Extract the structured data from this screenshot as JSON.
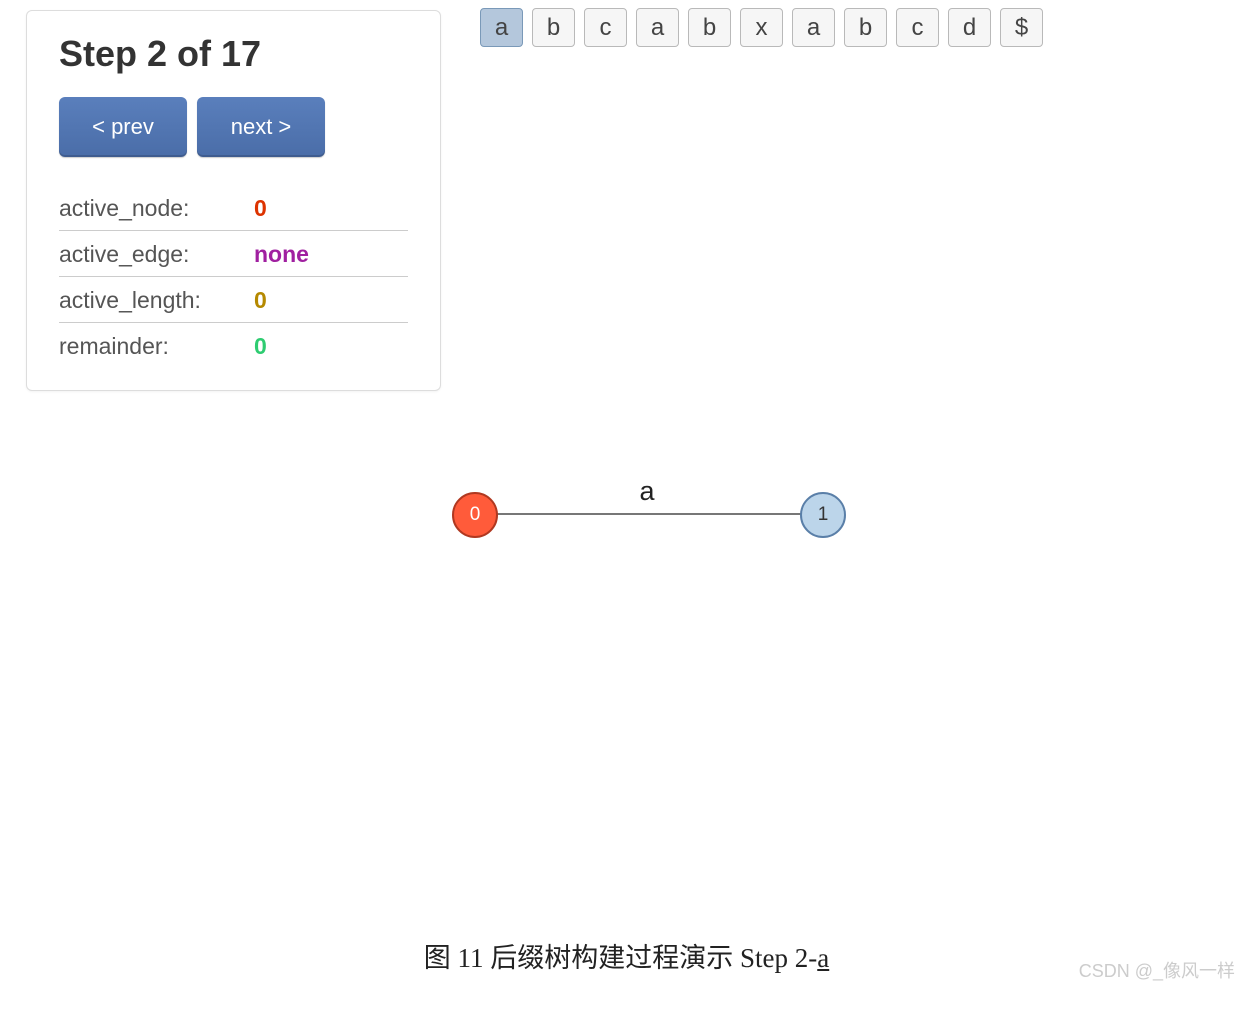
{
  "panel": {
    "title": "Step 2 of 17",
    "prev_label": "< prev",
    "next_label": "next >",
    "stats": {
      "active_node": {
        "label": "active_node:",
        "value": "0",
        "cls": "v-red"
      },
      "active_edge": {
        "label": "active_edge:",
        "value": "none",
        "cls": "v-purple"
      },
      "active_length": {
        "label": "active_length:",
        "value": "0",
        "cls": "v-olive"
      },
      "remainder": {
        "label": "remainder:",
        "value": "0",
        "cls": "v-green"
      }
    }
  },
  "input": {
    "chars": [
      "a",
      "b",
      "c",
      "a",
      "b",
      "x",
      "a",
      "b",
      "c",
      "d",
      "$"
    ],
    "active_index": 0
  },
  "graph": {
    "nodes": [
      {
        "id": "0",
        "cls": "node0"
      },
      {
        "id": "1",
        "cls": "node1"
      }
    ],
    "edge_label": "a"
  },
  "caption_prefix": "图 11  后缀树构建过程演示 Step 2-",
  "caption_step_char": "a",
  "watermark": "CSDN @_像风一样"
}
